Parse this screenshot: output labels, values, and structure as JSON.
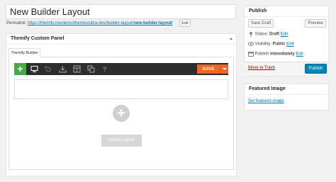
{
  "post": {
    "title": "New Builder Layout",
    "permalink_label": "Permalink:",
    "permalink_base": "https://themify.me/demo/themes/ultra-dev/builder-layout/",
    "permalink_slug": "new-builder-layout/",
    "permalink_edit_label": "Edit"
  },
  "custom_panel": {
    "title": "Themify Custom Panel",
    "tab_label": "Themify Builder",
    "toolbar": {
      "add_icon": "plus-icon",
      "icons": [
        "desktop-icon",
        "undo-icon",
        "download-icon",
        "layout-icon",
        "duplicate-icon",
        "help-icon"
      ],
      "save_label": "SAVE",
      "save_color": "#f26522",
      "add_color": "#47a947"
    },
    "import_label": "Import Layout"
  },
  "publish_box": {
    "title": "Publish",
    "save_draft_label": "Save Draft",
    "preview_label": "Preview",
    "status_label": "Status:",
    "status_value": "Draft",
    "status_edit": "Edit",
    "visibility_label": "Visibility:",
    "visibility_value": "Public",
    "visibility_edit": "Edit",
    "publish_label": "Publish",
    "publish_value": "immediately",
    "publish_edit": "Edit",
    "trash_label": "Move to Trash",
    "publish_button_label": "Publish"
  },
  "featured_image": {
    "title": "Featured Image",
    "link_label": "Set featured image"
  }
}
